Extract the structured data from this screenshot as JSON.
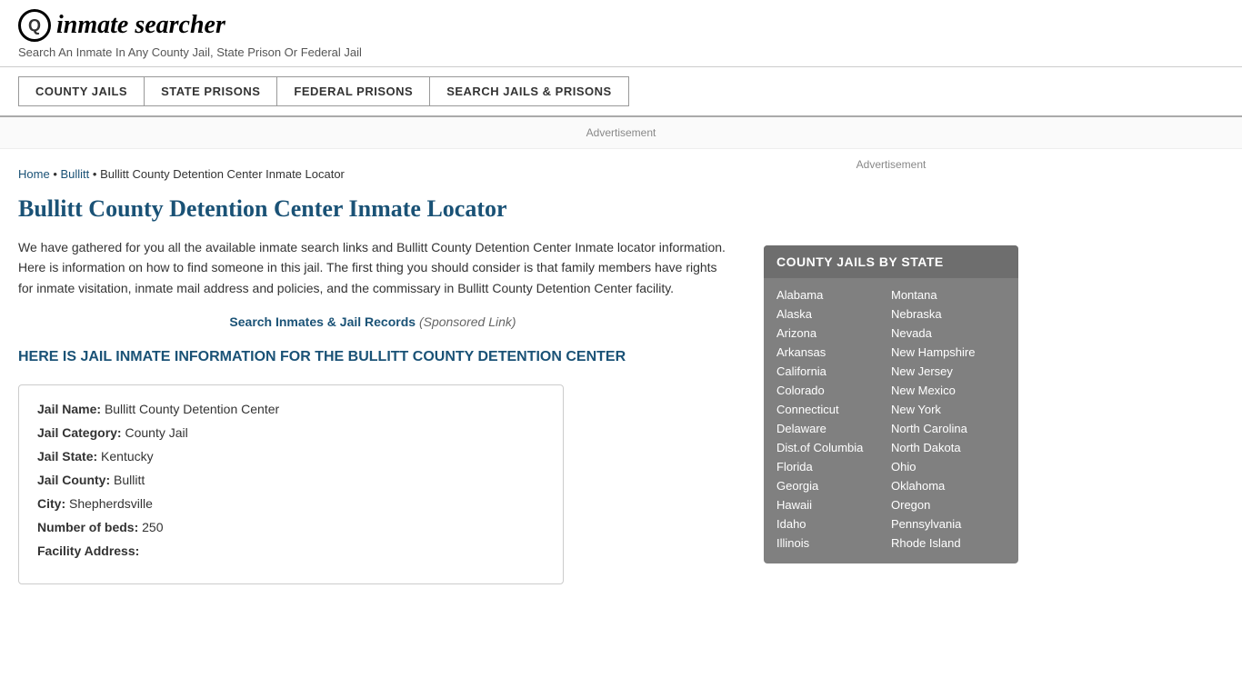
{
  "header": {
    "logo_icon": "🔍",
    "logo_text": "inmate searcher",
    "tagline": "Search An Inmate In Any County Jail, State Prison Or Federal Jail"
  },
  "nav": {
    "buttons": [
      {
        "label": "COUNTY JAILS",
        "id": "county-jails"
      },
      {
        "label": "STATE PRISONS",
        "id": "state-prisons"
      },
      {
        "label": "FEDERAL PRISONS",
        "id": "federal-prisons"
      },
      {
        "label": "SEARCH JAILS & PRISONS",
        "id": "search-jails"
      }
    ]
  },
  "ad_label": "Advertisement",
  "breadcrumb": {
    "home_label": "Home",
    "separator": "•",
    "bullitt_label": "Bullitt",
    "current": "Bullitt County Detention Center Inmate Locator"
  },
  "page_title": "Bullitt County Detention Center Inmate Locator",
  "body_text": "We have gathered for you all the available inmate search links and Bullitt County Detention Center Inmate locator information. Here is information on how to find someone in this jail. The first thing you should consider is that family members have rights for inmate visitation, inmate mail address and policies, and the commissary in Bullitt County Detention Center facility.",
  "sponsored": {
    "link_text": "Search Inmates & Jail Records",
    "label": "(Sponsored Link)"
  },
  "section_heading": "HERE IS JAIL INMATE INFORMATION FOR THE BULLITT COUNTY DETENTION CENTER",
  "info_box": {
    "fields": [
      {
        "label": "Jail Name:",
        "value": "Bullitt County Detention Center"
      },
      {
        "label": "Jail Category:",
        "value": "County Jail"
      },
      {
        "label": "Jail State:",
        "value": "Kentucky"
      },
      {
        "label": "Jail County:",
        "value": "Bullitt"
      },
      {
        "label": "City:",
        "value": "Shepherdsville"
      },
      {
        "label": "Number of beds:",
        "value": "250"
      },
      {
        "label": "Facility Address:",
        "value": ""
      }
    ]
  },
  "sidebar": {
    "ad_label": "Advertisement",
    "state_box": {
      "title": "COUNTY JAILS BY STATE",
      "states_left": [
        "Alabama",
        "Alaska",
        "Arizona",
        "Arkansas",
        "California",
        "Colorado",
        "Connecticut",
        "Delaware",
        "Dist.of Columbia",
        "Florida",
        "Georgia",
        "Hawaii",
        "Idaho",
        "Illinois"
      ],
      "states_right": [
        "Montana",
        "Nebraska",
        "Nevada",
        "New Hampshire",
        "New Jersey",
        "New Mexico",
        "New York",
        "North Carolina",
        "North Dakota",
        "Ohio",
        "Oklahoma",
        "Oregon",
        "Pennsylvania",
        "Rhode Island"
      ]
    }
  }
}
